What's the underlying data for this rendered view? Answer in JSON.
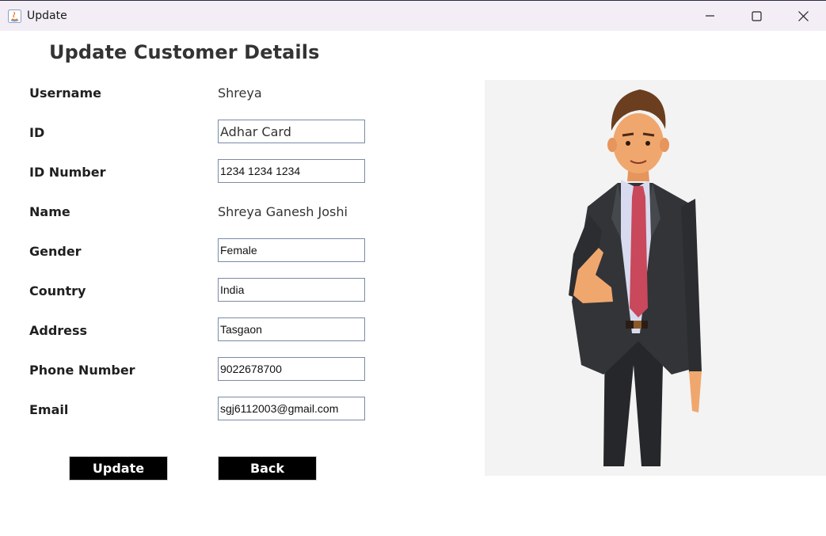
{
  "window": {
    "title": "Update",
    "minimize_icon": "minimize-icon",
    "maximize_icon": "maximize-icon",
    "close_icon": "close-icon"
  },
  "form": {
    "heading": "Update Customer Details",
    "fields": {
      "username": {
        "label": "Username",
        "value": "Shreya"
      },
      "id": {
        "label": "ID",
        "value": "Adhar Card"
      },
      "id_number": {
        "label": "ID Number",
        "value": "1234 1234 1234"
      },
      "name": {
        "label": "Name",
        "value": "Shreya Ganesh Joshi"
      },
      "gender": {
        "label": "Gender",
        "value": "Female"
      },
      "country": {
        "label": "Country",
        "value": "India"
      },
      "address": {
        "label": "Address",
        "value": "Tasgaon"
      },
      "phone": {
        "label": "Phone Number",
        "value": "9022678700"
      },
      "email": {
        "label": "Email",
        "value": "sgj6112003@gmail.com"
      }
    },
    "buttons": {
      "update": "Update",
      "back": "Back"
    }
  },
  "colors": {
    "titlebar": "#f3eef6",
    "button_bg": "#000000",
    "button_text": "#ffffff",
    "illustration_bg": "#f3f3f3"
  },
  "illustration": "businessman-offering-handshake"
}
